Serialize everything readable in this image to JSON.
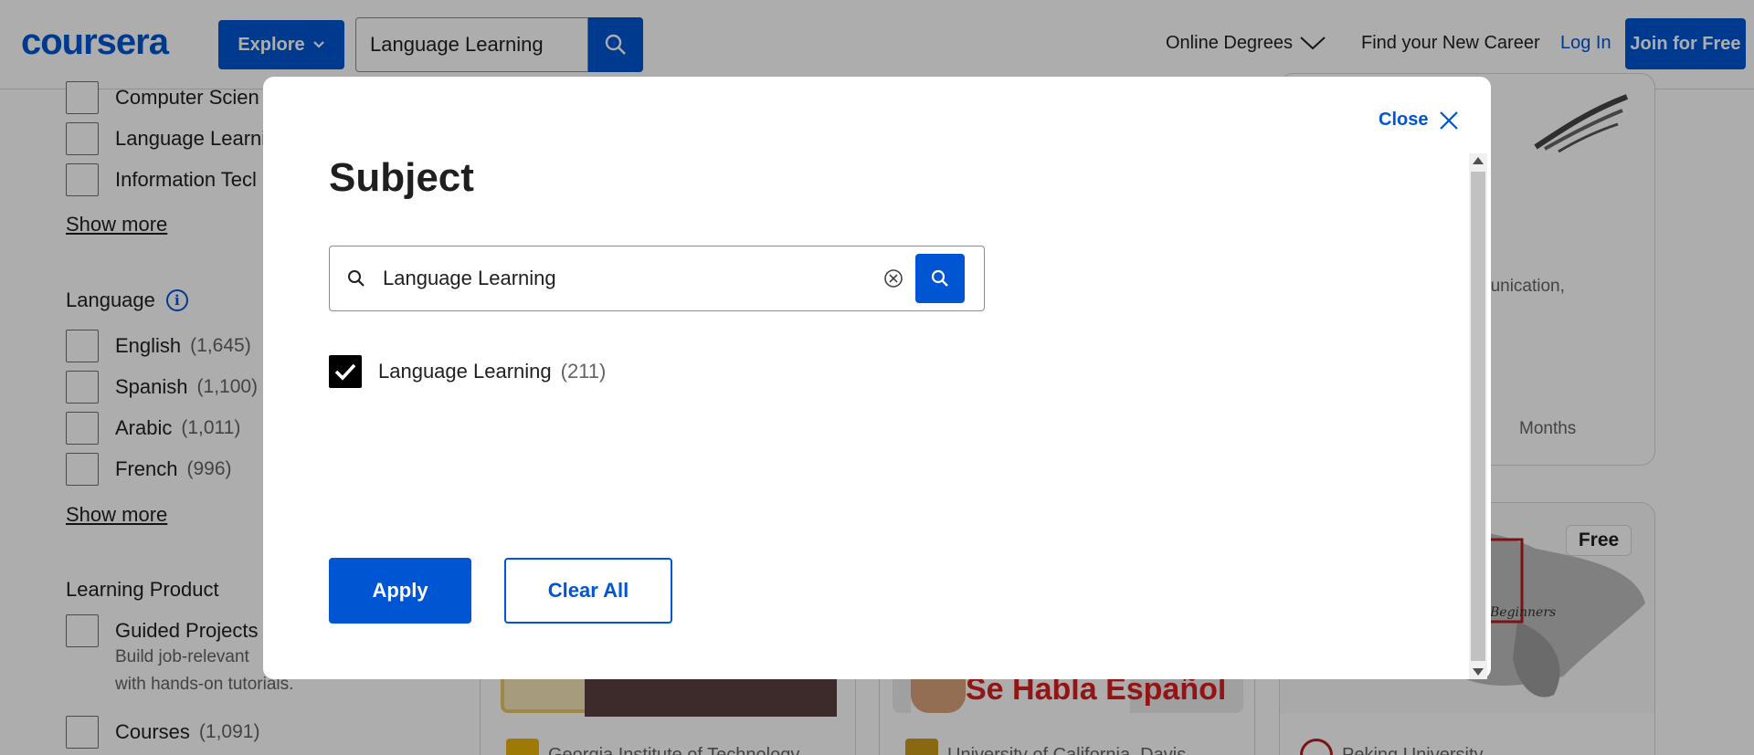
{
  "header": {
    "logo": "coursera",
    "explore_label": "Explore",
    "search_value": "Language Learning",
    "nav": {
      "online_degrees": "Online Degrees",
      "find_career": "Find your New Career",
      "login": "Log In",
      "join": "Join for Free"
    }
  },
  "sidebar": {
    "subject_items": [
      {
        "label": "Computer Scien"
      },
      {
        "label": "Language Learni"
      },
      {
        "label": "Information Tecl"
      }
    ],
    "show_more_1": "Show more",
    "language_title": "Language",
    "language_items": [
      {
        "label": "English",
        "count": "(1,645)"
      },
      {
        "label": "Spanish",
        "count": "(1,100)"
      },
      {
        "label": "Arabic",
        "count": "(1,011)"
      },
      {
        "label": "French",
        "count": "(996)"
      }
    ],
    "show_more_2": "Show more",
    "learning_product_title": "Learning Product",
    "guided_projects": {
      "label": "Guided Projects",
      "desc_line1": "Build job-relevant",
      "desc_line2": "with hands-on tutorials."
    },
    "courses": {
      "label": "Courses",
      "count": "(1,091)"
    }
  },
  "cards": {
    "card1_partner": "Georgia Institute of Technology",
    "card2_partner": "University of California, Davis",
    "card3_partner": "Peking University",
    "card2_image_text": "Se Habla Español",
    "card3_image_text": "Beginners",
    "free_badge": "Free",
    "top_right_text": "nunication,",
    "top_right_duration": "Months"
  },
  "modal": {
    "close_label": "Close",
    "title": "Subject",
    "search_value": "Language Learning",
    "result": {
      "label": "Language Learning",
      "count": "(211)",
      "checked": true
    },
    "apply_label": "Apply",
    "clear_label": "Clear All"
  },
  "colors": {
    "brand_blue": "#0056d2",
    "overlay": "rgba(0,0,0,0.32)",
    "text": "#1f1f1f",
    "muted": "#636363"
  }
}
